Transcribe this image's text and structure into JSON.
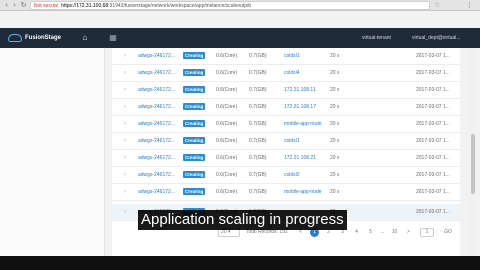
{
  "browser": {
    "back_icon": "back-arrow-icon",
    "forward_icon": "forward-arrow-icon",
    "refresh_icon": "refresh-icon",
    "address_warning": "Not secure",
    "address_host": "https://172.31.100.68",
    "address_path": ":31943/fusionstage/network/workspace/app/instance/scaleoutjob",
    "star_icon": "bookmark-star-icon",
    "menu_icon": "menu-dots-icon"
  },
  "app": {
    "logo_text": "FusionStage",
    "home_icon": "home-icon",
    "apps_icon": "grid-icon",
    "user_label": "virtual-tenant",
    "project_label": "virtual_dept@virtual..."
  },
  "rows": [
    {
      "name": "adwgs-246172...",
      "status": "Creating",
      "cpu": "0.6(Core)",
      "mem": "0.7(GB)",
      "ip": "coldsl1",
      "count": "20 s",
      "date": "2017-03-07 1..."
    },
    {
      "name": "adwgs-246172...",
      "status": "Creating",
      "cpu": "0.6(Core)",
      "mem": "0.7(GB)",
      "ip": "coldsl4",
      "count": "20 s",
      "date": "2017-03-07 1..."
    },
    {
      "name": "adwgs-246172...",
      "status": "Creating",
      "cpu": "0.6(Core)",
      "mem": "0.7(GB)",
      "ip": "172.31.108.11",
      "count": "20 s",
      "date": "2017-03-07 1..."
    },
    {
      "name": "adwgs-246172...",
      "status": "Creating",
      "cpu": "0.6(Core)",
      "mem": "0.7(GB)",
      "ip": "172.31.108.17",
      "count": "20 s",
      "date": "2017-03-07 1..."
    },
    {
      "name": "adwgs-246172...",
      "status": "Creating",
      "cpu": "0.6(Core)",
      "mem": "0.7(GB)",
      "ip": "mobile-app-node",
      "count": "20 s",
      "date": "2017-03-07 1..."
    },
    {
      "name": "adwgs-246172...",
      "status": "Creating",
      "cpu": "0.6(Core)",
      "mem": "0.7(GB)",
      "ip": "coldsl1",
      "count": "20 s",
      "date": "2017-03-07 1..."
    },
    {
      "name": "adwgs-246172...",
      "status": "Creating",
      "cpu": "0.6(Core)",
      "mem": "0.7(GB)",
      "ip": "172.31.108.21",
      "count": "20 s",
      "date": "2017-03-07 1..."
    },
    {
      "name": "adwgs-246172...",
      "status": "Creating",
      "cpu": "0.6(Core)",
      "mem": "0.7(GB)",
      "ip": "coldsl2",
      "count": "20 s",
      "date": "2017-03-07 1..."
    },
    {
      "name": "adwgs-246172...",
      "status": "Creating",
      "cpu": "0.6(Core)",
      "mem": "0.7(GB)",
      "ip": "mobile-app-node",
      "count": "20 s",
      "date": "2017-03-07 1..."
    },
    {
      "name": "adwgs-246172...",
      "status": "Creating",
      "cpu": "0.6(Core)",
      "mem": "0.7(GB)",
      "ip": "",
      "count": "20 s",
      "date": "2017-03-07 1..."
    }
  ],
  "pager": {
    "page_size": "20",
    "total": "Total Records: 192",
    "prev": "<",
    "pages": [
      "1",
      "2",
      "3",
      "4",
      "5",
      "...",
      "10"
    ],
    "next": ">",
    "goto_value": "1",
    "go_label": "GO"
  },
  "caption": "Application scaling in progress",
  "colors": {
    "header_bg": "#1f2a3a",
    "badge_bg": "#2d8ccf",
    "link": "#2b7cc9"
  }
}
